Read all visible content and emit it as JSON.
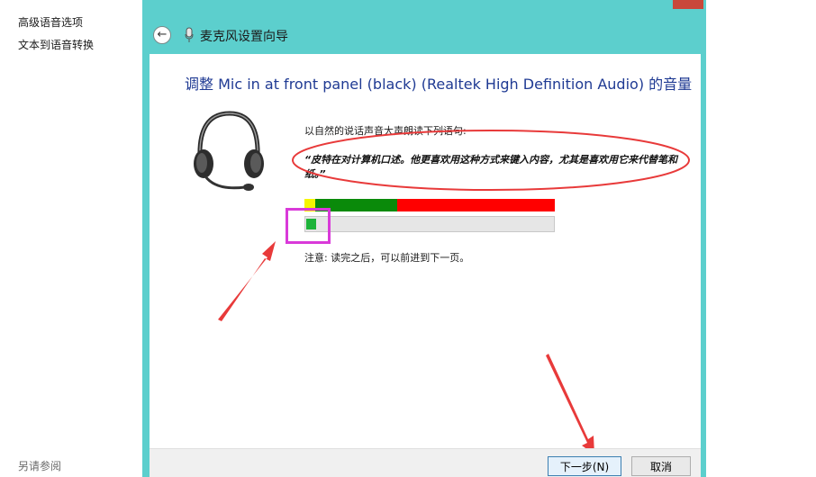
{
  "left_panel": {
    "links": [
      "高级语音选项",
      "文本到语音转换"
    ],
    "footer": "另请参阅"
  },
  "window": {
    "title": "麦克风设置向导",
    "back_icon": "back-arrow-icon",
    "mic_icon": "microphone-icon"
  },
  "content": {
    "heading": "调整 Mic in at front panel (black) (Realtek High Definition Audio) 的音量",
    "instruction": "以自然的说话声音大声朗读下列语句:",
    "quote": "“皮特在对计算机口述。他更喜欢用这种方式来键入内容，尤其是喜欢用它来代替笔和纸。”",
    "note": "注意: 读完之后，可以前进到下一页。",
    "input_level": 0.04
  },
  "colors": {
    "frame": "#5ccfcd",
    "meter_yellow": "#f5f500",
    "meter_green": "#0a8a0a",
    "meter_red": "#ff0000",
    "level_fill": "#1db33a",
    "annotation_red": "#e83a3a",
    "annotation_magenta": "#d93ad9"
  },
  "footer": {
    "next_label": "下一步(N)",
    "cancel_label": "取消"
  }
}
